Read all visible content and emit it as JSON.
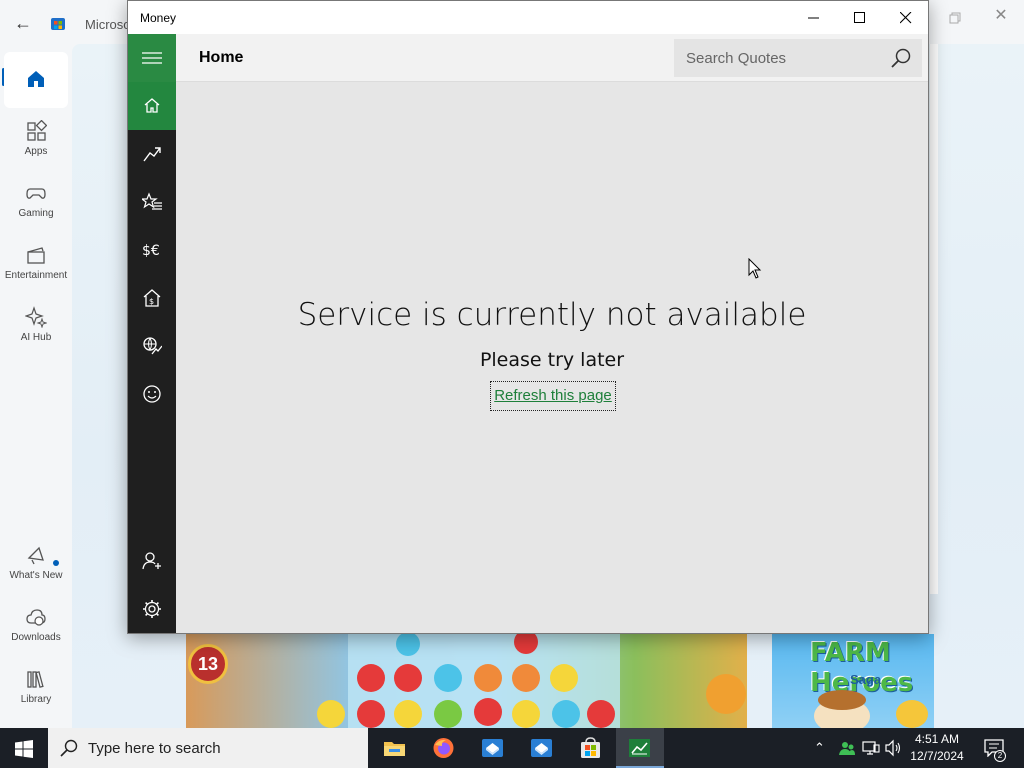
{
  "store": {
    "title": "Microso",
    "nav": [
      {
        "label": "",
        "icon": "home-icon"
      },
      {
        "label": "Apps",
        "icon": "apps-icon"
      },
      {
        "label": "Gaming",
        "icon": "gamepad-icon"
      },
      {
        "label": "Entertainment",
        "icon": "film-icon"
      },
      {
        "label": "AI Hub",
        "icon": "sparkle-icon"
      }
    ],
    "nav_bottom": [
      {
        "label": "What's New",
        "icon": "megaphone-icon"
      },
      {
        "label": "Downloads",
        "icon": "cloud-download-icon"
      },
      {
        "label": "Library",
        "icon": "library-icon"
      }
    ],
    "banners": {
      "level_number": "13",
      "farm_title": "FARM Heroes",
      "farm_subtitle": "Saga"
    }
  },
  "money": {
    "window_title": "Money",
    "header_title": "Home",
    "search_placeholder": "Search Quotes",
    "rail_icons": [
      "hamburger-menu-icon",
      "home-icon",
      "trend-chart-icon",
      "star-list-icon",
      "currency-icon",
      "mortgage-home-icon",
      "world-markets-icon",
      "smiley-icon",
      "add-person-icon",
      "settings-gear-icon"
    ],
    "error_title": "Service is currently not available",
    "error_subtitle": "Please try later",
    "refresh_link": "Refresh this page",
    "accent_color": "#2a8a43"
  },
  "taskbar": {
    "search_placeholder": "Type here to search",
    "apps": [
      "file-explorer-icon",
      "firefox-icon",
      "sandbox-icon",
      "sandbox-icon",
      "store-icon",
      "money-icon"
    ],
    "time": "4:51 AM",
    "date": "12/7/2024",
    "notification_count": "2"
  }
}
